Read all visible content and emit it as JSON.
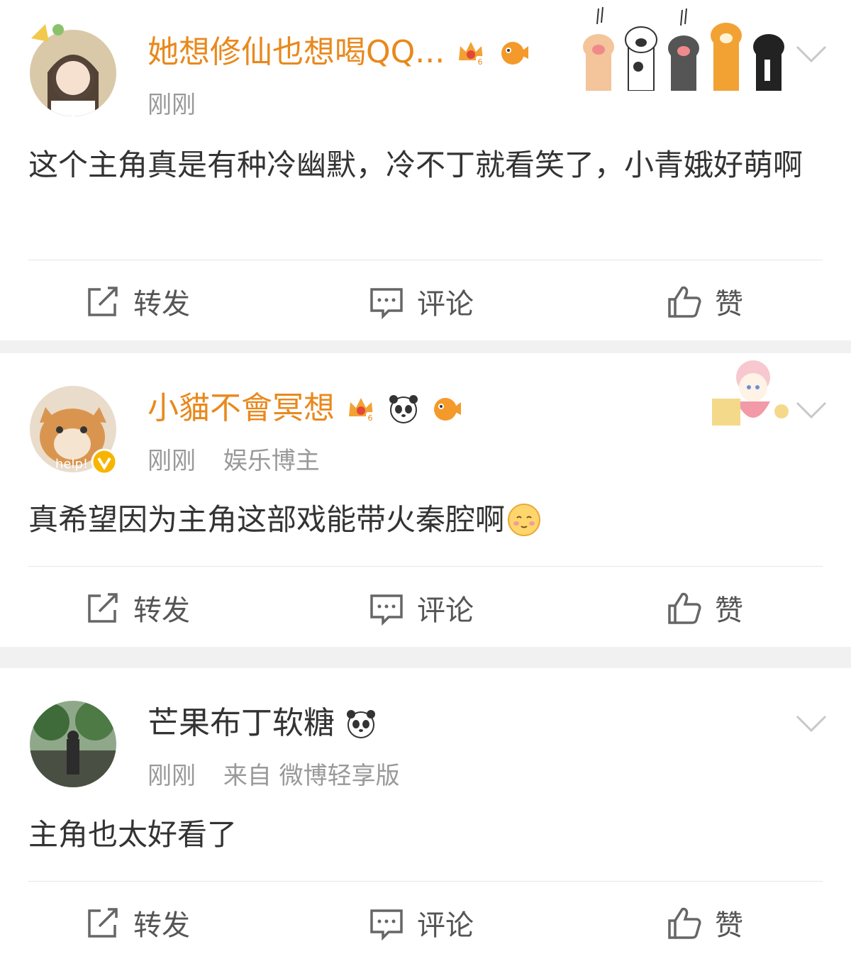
{
  "posts": [
    {
      "username": "她想修仙也想喝QQ...",
      "time": "刚刚",
      "tag": "",
      "source": "",
      "content": "这个主角真是有种冷幽默，冷不丁就看笑了，小青娥好萌啊",
      "name_style": "vip",
      "badges": [
        "crown-6-badge",
        "pufferfish-badge"
      ],
      "decoration": "cat-paws-card-decoration"
    },
    {
      "username": "小貓不會冥想",
      "time": "刚刚",
      "tag": "娱乐博主",
      "source": "",
      "content": "真希望因为主角这部戏能带火秦腔啊",
      "content_emoji": "blush-emoji",
      "name_style": "vip",
      "verified": true,
      "avatar_text": "help!",
      "badges": [
        "crown-6-badge",
        "panda-badge",
        "pufferfish-badge"
      ],
      "decoration": "bunny-girl-card-decoration"
    },
    {
      "username": "芒果布丁软糖",
      "time": "刚刚",
      "tag": "",
      "source": "来自 微博轻享版",
      "content": "主角也太好看了",
      "name_style": "plain",
      "badges": [
        "panda-badge"
      ],
      "decoration": ""
    }
  ],
  "actions": {
    "repost": "转发",
    "comment": "评论",
    "like": "赞"
  },
  "colors": {
    "vip_name": "#e8891d",
    "text": "#333333",
    "meta": "#999999",
    "background": "#f1f1f1"
  }
}
